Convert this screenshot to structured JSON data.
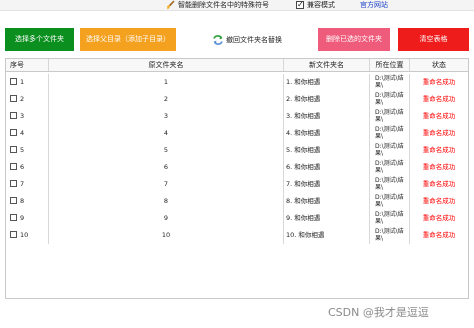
{
  "topbar": {
    "title": "智能删除文件名中的特殊符号",
    "compat_checked": true,
    "compat_mark": "✓",
    "compat_label": "兼容模式",
    "site_link": "官方网站"
  },
  "toolbar": {
    "select_folders": "选择多个文件夹",
    "choose_parent": "选择父目录（添加子目录）",
    "revert": "撤回文件夹名替换",
    "delete_selected": "删除已选的文件夹",
    "clear_table": "清空表格"
  },
  "table": {
    "columns": [
      "序号",
      "原文件夹名",
      "新文件夹名",
      "所在位置",
      "状态"
    ],
    "rows": [
      {
        "index": "1",
        "original": "1",
        "new": "1. 和你相遇",
        "location": "D:\\测试\\结果\\",
        "status": "重命名成功"
      },
      {
        "index": "2",
        "original": "2",
        "new": "2. 和你相遇",
        "location": "D:\\测试\\结果\\",
        "status": "重命名成功"
      },
      {
        "index": "3",
        "original": "3",
        "new": "3. 和你相遇",
        "location": "D:\\测试\\结果\\",
        "status": "重命名成功"
      },
      {
        "index": "4",
        "original": "4",
        "new": "4. 和你相遇",
        "location": "D:\\测试\\结果\\",
        "status": "重命名成功"
      },
      {
        "index": "5",
        "original": "5",
        "new": "5. 和你相遇",
        "location": "D:\\测试\\结果\\",
        "status": "重命名成功"
      },
      {
        "index": "6",
        "original": "6",
        "new": "6. 和你相遇",
        "location": "D:\\测试\\结果\\",
        "status": "重命名成功"
      },
      {
        "index": "7",
        "original": "7",
        "new": "7. 和你相遇",
        "location": "D:\\测试\\结果\\",
        "status": "重命名成功"
      },
      {
        "index": "8",
        "original": "8",
        "new": "8. 和你相遇",
        "location": "D:\\测试\\结果\\",
        "status": "重命名成功"
      },
      {
        "index": "9",
        "original": "9",
        "new": "9. 和你相遇",
        "location": "D:\\测试\\结果\\",
        "status": "重命名成功"
      },
      {
        "index": "10",
        "original": "10",
        "new": "10. 和你相遇",
        "location": "D:\\测试\\结果\\",
        "status": "重命名成功"
      }
    ]
  },
  "watermark": "CSDN @我才是逗逗",
  "icons": {
    "title_icon": "brush-icon",
    "revert_icon": "recycle-icon",
    "row_checkbox": "checkbox-icon"
  },
  "colors": {
    "select_button": "#0b8f1f",
    "parent_button": "#f4a11f",
    "delete_button": "#ef5b7a",
    "clear_button": "#ef1c1c",
    "status_text": "#ff0000",
    "link": "#1a3fc7"
  }
}
